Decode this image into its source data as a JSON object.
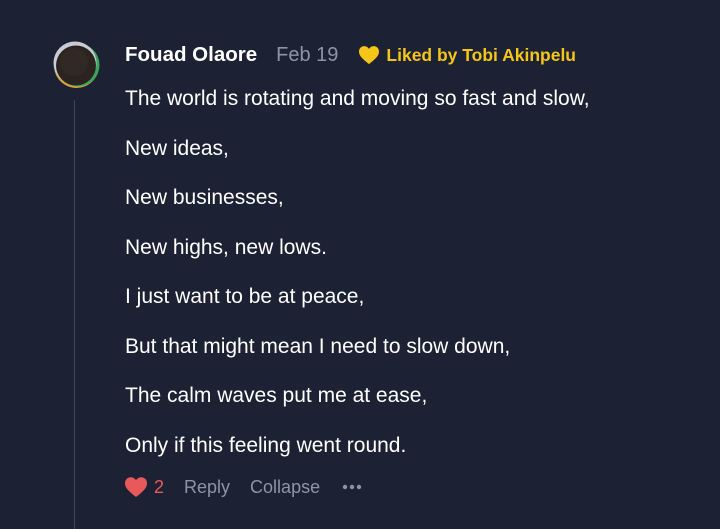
{
  "comment": {
    "author": "Fouad Olaore",
    "date": "Feb 19",
    "liked_by": "Liked by Tobi Akinpelu",
    "lines": [
      "The world is rotating and moving so fast and slow,",
      "New ideas,",
      "New businesses,",
      "New highs, new lows.",
      "I just want to be at peace,",
      "But that might mean I need to slow down,",
      "The calm waves put me at ease,",
      "Only if this feeling went round."
    ],
    "like_count": "2",
    "reply_label": "Reply",
    "collapse_label": "Collapse"
  },
  "icons": {
    "liked_heart": "heart-icon",
    "like_heart": "heart-icon",
    "more": "ellipsis-icon"
  },
  "colors": {
    "background": "#1c2233",
    "liked_yellow": "#f5c518",
    "heart_red": "#e8595b",
    "muted_text": "#8e94a4",
    "thread_line": "#3f4556"
  }
}
